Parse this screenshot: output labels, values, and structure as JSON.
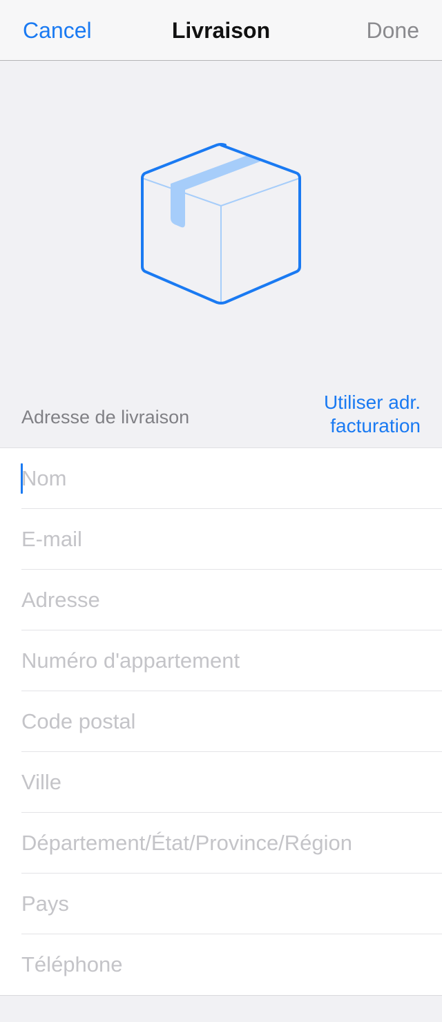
{
  "navbar": {
    "cancel_label": "Cancel",
    "title": "Livraison",
    "done_label": "Done"
  },
  "hero": {
    "icon": "package-box-icon",
    "accent_color": "#1a7af2",
    "tape_color": "#a6cdfa"
  },
  "section": {
    "label": "Adresse de livraison",
    "use_billing_label_line1": "Utiliser adr.",
    "use_billing_label_line2": "facturation"
  },
  "form": {
    "fields": [
      {
        "name": "name-field",
        "placeholder": "Nom",
        "value": "",
        "focused": true
      },
      {
        "name": "email-field",
        "placeholder": "E-mail",
        "value": ""
      },
      {
        "name": "address-field",
        "placeholder": "Adresse",
        "value": ""
      },
      {
        "name": "apartment-field",
        "placeholder": "Numéro d'appartement",
        "value": ""
      },
      {
        "name": "postal-code-field",
        "placeholder": "Code postal",
        "value": ""
      },
      {
        "name": "city-field",
        "placeholder": "Ville",
        "value": ""
      },
      {
        "name": "region-field",
        "placeholder": "Département/État/Province/Région",
        "value": ""
      },
      {
        "name": "country-field",
        "placeholder": "Pays",
        "value": ""
      },
      {
        "name": "phone-field",
        "placeholder": "Téléphone",
        "value": ""
      }
    ]
  }
}
